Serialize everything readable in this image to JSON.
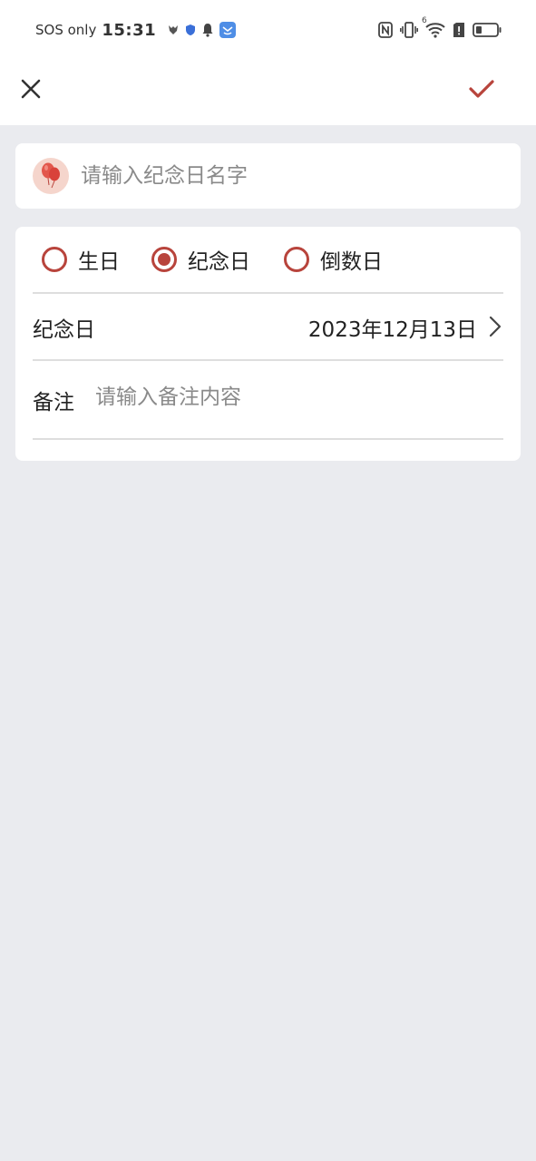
{
  "status_bar": {
    "carrier": "SOS only",
    "time": "15:31",
    "icons": [
      "app-mascot-icon",
      "shield-icon",
      "bell-icon",
      "app-badge-icon",
      "nfc-icon",
      "vibrate-icon",
      "wifi-icon",
      "sim-alert-icon",
      "battery-icon"
    ],
    "wifi_badge": "6"
  },
  "toolbar": {
    "close_icon": "close-icon",
    "confirm_icon": "check-icon",
    "accent_color": "#b8443c"
  },
  "name_field": {
    "icon": "balloon-icon",
    "placeholder": "请输入纪念日名字",
    "value": ""
  },
  "type_options": [
    {
      "label": "生日",
      "selected": false
    },
    {
      "label": "纪念日",
      "selected": true
    },
    {
      "label": "倒数日",
      "selected": false
    }
  ],
  "date_row": {
    "label": "纪念日",
    "value": "2023年12月13日",
    "icon": "chevron-right-icon"
  },
  "note_row": {
    "label": "备注",
    "placeholder": "请输入备注内容",
    "value": ""
  },
  "colors": {
    "accent": "#b8443c",
    "background": "#eaebef",
    "card": "#ffffff",
    "badge_bg": "#f5d5cc"
  }
}
